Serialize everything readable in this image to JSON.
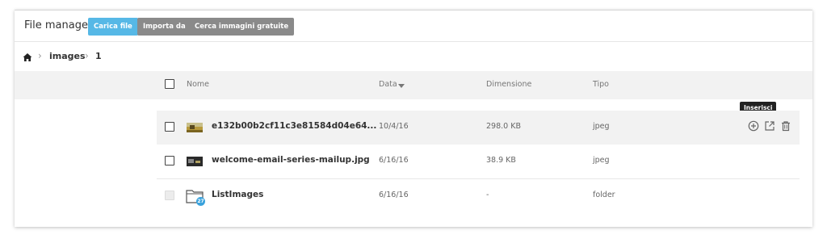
{
  "header": {
    "title": "File manager",
    "buttons": {
      "upload": "Carica file",
      "import": "Importa da",
      "free_images": "Cerca immagini gratuite"
    }
  },
  "breadcrumb": {
    "home_icon": "home-icon",
    "items": [
      "images",
      "1"
    ]
  },
  "columns": {
    "name": "Nome",
    "date": "Data",
    "size": "Dimensione",
    "type": "Tipo"
  },
  "rows": [
    {
      "name": "e132b00b2cf11c3e81584d04e64...",
      "date": "10/4/16",
      "size": "298.0 KB",
      "type": "jpeg",
      "icon": "image-thumbnail-icon"
    },
    {
      "name": "welcome-email-series-mailup.jpg",
      "date": "6/16/16",
      "size": "38.9 KB",
      "type": "jpeg",
      "icon": "image-thumbnail-icon"
    },
    {
      "name": "ListImages",
      "date": "6/16/16",
      "size": "-",
      "type": "folder",
      "icon": "folder-icon",
      "badge": "27"
    }
  ],
  "actions": {
    "tooltip": "Inserisci",
    "icons": [
      "plus-circle-icon",
      "external-link-icon",
      "trash-icon"
    ]
  },
  "colors": {
    "accent_blue": "#56b8e6",
    "secondary_gray": "#8a8a8a",
    "badge_blue": "#3aa2dc"
  }
}
